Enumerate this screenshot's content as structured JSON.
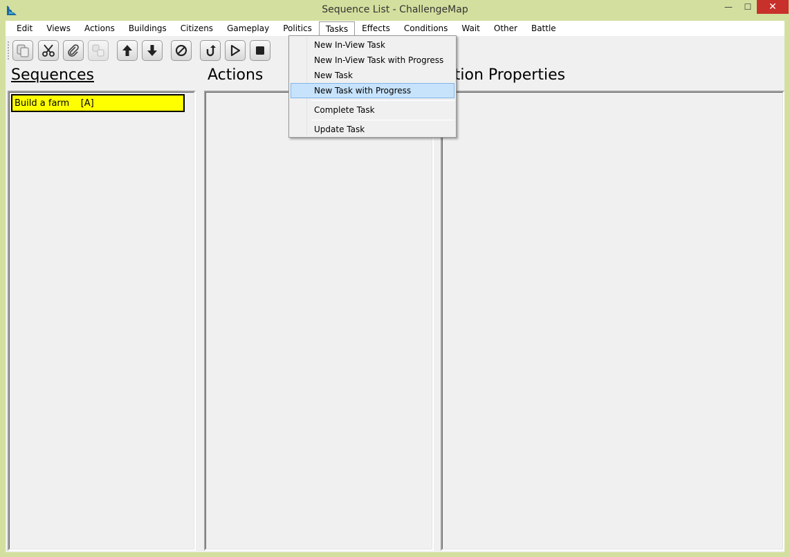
{
  "window": {
    "title": "Sequence List - ChallengeMap",
    "controls": {
      "minimize": "—",
      "maximize": "☐",
      "close": "✕"
    }
  },
  "menubar": {
    "items": [
      {
        "label": "Edit"
      },
      {
        "label": "Views"
      },
      {
        "label": "Actions"
      },
      {
        "label": "Buildings"
      },
      {
        "label": "Citizens"
      },
      {
        "label": "Gameplay"
      },
      {
        "label": "Politics"
      },
      {
        "label": "Tasks"
      },
      {
        "label": "Effects"
      },
      {
        "label": "Conditions"
      },
      {
        "label": "Wait"
      },
      {
        "label": "Other"
      },
      {
        "label": "Battle"
      }
    ],
    "open_menu": "Tasks"
  },
  "toolbar": {
    "buttons": [
      {
        "icon": "copy-icon"
      },
      {
        "icon": "scissors-icon"
      },
      {
        "icon": "paperclip-icon"
      },
      {
        "icon": "duplicate-icon"
      },
      {
        "icon": "arrow-up-icon"
      },
      {
        "icon": "arrow-down-icon"
      },
      {
        "icon": "disable-icon"
      },
      {
        "icon": "undo-icon"
      },
      {
        "icon": "play-icon"
      },
      {
        "icon": "stop-icon"
      }
    ]
  },
  "panels": {
    "sequences": {
      "title": "Sequences",
      "items": [
        {
          "label": "Build a farm    [A]",
          "color": "#ffff00"
        }
      ]
    },
    "actions": {
      "title": "Actions"
    },
    "action_properties": {
      "title": "Action Properties"
    }
  },
  "tasks_menu": {
    "items": [
      {
        "label": "New In-View Task"
      },
      {
        "label": "New In-View Task with Progress"
      },
      {
        "label": "New Task"
      },
      {
        "label": "New Task with Progress",
        "highlighted": true
      },
      {
        "label": "Complete Task"
      },
      {
        "label": "Update Task"
      }
    ]
  },
  "colors": {
    "frame": "#d3df9e",
    "highlight": "#c7e3fb",
    "close": "#c7302b",
    "selected_sequence": "#ffff00"
  }
}
